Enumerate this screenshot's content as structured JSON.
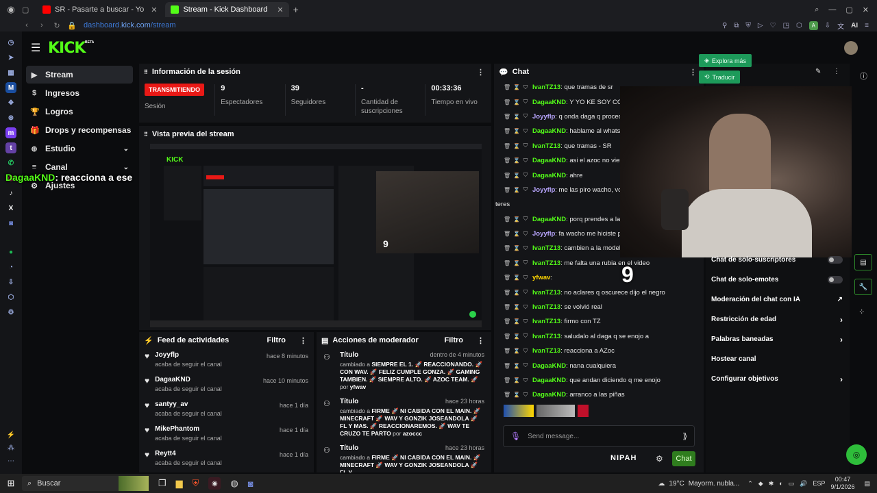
{
  "browser": {
    "tabs": [
      {
        "label": "SR - Pasarte a buscar - Yo",
        "color": "#ff0000",
        "active": false
      },
      {
        "label": "Stream - Kick Dashboard",
        "color": "#53fc18",
        "active": true
      }
    ],
    "url_domain": "dashboard.",
    "url_host": "kick.com",
    "url_path": "/stream"
  },
  "header": {
    "logo": "KICK",
    "beta": "BETA"
  },
  "nav": {
    "items": [
      {
        "label": "Stream",
        "icon": "▶"
      },
      {
        "label": "Ingresos",
        "icon": "$"
      },
      {
        "label": "Logros",
        "icon": "🏆"
      },
      {
        "label": "Drops y recompensas",
        "icon": "🎁"
      },
      {
        "label": "Estudio",
        "icon": "⊕"
      },
      {
        "label": "Canal",
        "icon": "≡"
      },
      {
        "label": "Ajustes",
        "icon": "⚙"
      }
    ],
    "overlay_user": "DagaaKND",
    "overlay_msg": ": reacciona a ese"
  },
  "session": {
    "title": "Información de la sesión",
    "status_badge": "TRANSMITIENDO",
    "status_label": "Sesión",
    "stats": [
      {
        "value": "9",
        "label": "Espectadores"
      },
      {
        "value": "39",
        "label": "Seguidores"
      },
      {
        "value": "-",
        "label": "Cantidad de suscripciones"
      },
      {
        "value": "00:33:36",
        "label": "Tiempo en vivo"
      }
    ]
  },
  "preview": {
    "title": "Vista previa del stream",
    "inner_logo": "KICK",
    "inner_number": "9"
  },
  "feed": {
    "title": "Feed de actividades",
    "filter": "Filtro",
    "items": [
      {
        "name": "Joyyflp",
        "sub": "acaba de seguir el canal",
        "time": "hace 8 minutos"
      },
      {
        "name": "DagaaKND",
        "sub": "acaba de seguir el canal",
        "time": "hace 10 minutos"
      },
      {
        "name": "santyy_av",
        "sub": "acaba de seguir el canal",
        "time": "hace 1 día"
      },
      {
        "name": "MikePhantom",
        "sub": "acaba de seguir el canal",
        "time": "hace 1 día"
      },
      {
        "name": "Reytt4",
        "sub": "acaba de seguir el canal",
        "time": "hace 1 día"
      }
    ]
  },
  "modactions": {
    "title": "Acciones de moderador",
    "filter": "Filtro",
    "items": [
      {
        "title": "Título",
        "time": "dentro de 4 minutos",
        "prefix": "cambiado a ",
        "body": "SIEMPRE EL 1. 🚀 REACCIONANDO. 🚀 CON WAV. 🚀 FELIZ CUMPLE GONZA. 🚀 GAMING TAMBIEN. 🚀 SIEMPRE ALTO. 🚀 AZOC TEAM. 🚀",
        "by": " por ",
        "user": "yfwav"
      },
      {
        "title": "Título",
        "time": "hace 23 horas",
        "prefix": "cambiado a ",
        "body": "FIRME 🚀 NI CABIDA CON EL MAIN. 🚀 MINECRAFT 🚀 WAV Y GONZIK JOSEANDOLA 🚀 FL Y MAS. 🚀 REACCIONAREMOS. 🚀 WAV TE CRUZO TE PARTO",
        "by": " por ",
        "user": "azoccc"
      },
      {
        "title": "Título",
        "time": "hace 23 horas",
        "prefix": "cambiado a ",
        "body": "FIRME 🚀 NI CABIDA CON EL MAIN. 🚀 MINECRAFT 🚀 WAV Y GONZIK JOSEANDOLA 🚀 FL Y",
        "by": "",
        "user": ""
      }
    ]
  },
  "chat": {
    "title": "Chat",
    "messages": [
      {
        "user": "IvanTZ13",
        "color": "#53fc18",
        "msg": ": que tramas de sr"
      },
      {
        "user": "DagaaKND",
        "color": "#53fc18",
        "msg": ": Y YO KE SOY COM"
      },
      {
        "user": "Joyyflp",
        "color": "#b9a6ff",
        "msg": ": q onda daga q proced"
      },
      {
        "user": "DagaaKND",
        "color": "#53fc18",
        "msg": ": hablame al whats"
      },
      {
        "user": "IvanTZ13",
        "color": "#53fc18",
        "msg": ": que tramas - SR"
      },
      {
        "user": "DagaaKND",
        "color": "#53fc18",
        "msg": ": asi el azoc no vien"
      },
      {
        "user": "DagaaKND",
        "color": "#53fc18",
        "msg": ": ahre"
      },
      {
        "user": "Joyyflp",
        "color": "#b9a6ff",
        "msg": ": me las piro wacho, vo"
      },
      {
        "user": "",
        "color": "#ffffff",
        "msg": "teres"
      },
      {
        "user": "DagaaKND",
        "color": "#53fc18",
        "msg": ": porq prendes a las"
      },
      {
        "user": "Joyyflp",
        "color": "#b9a6ff",
        "msg": ": fa wacho me hiciste p"
      },
      {
        "user": "IvanTZ13",
        "color": "#53fc18",
        "msg": ": cambien a la modelo"
      },
      {
        "user": "IvanTZ13",
        "color": "#53fc18",
        "msg": ": me falta una rubia en el video"
      },
      {
        "user": "yfwav",
        "color": "#ffd600",
        "msg": ":"
      },
      {
        "user": "IvanTZ13",
        "color": "#53fc18",
        "msg": ": no aclares q oscurece dijo el negro"
      },
      {
        "user": "IvanTZ13",
        "color": "#53fc18",
        "msg": ": se volvió real"
      },
      {
        "user": "IvanTZ13",
        "color": "#53fc18",
        "msg": ": firmo con TZ"
      },
      {
        "user": "IvanTZ13",
        "color": "#53fc18",
        "msg": ": saludalo al daga q se enojo a"
      },
      {
        "user": "IvanTZ13",
        "color": "#53fc18",
        "msg": ": reacciona a AZoc"
      },
      {
        "user": "DagaaKND",
        "color": "#53fc18",
        "msg": ": nana cualquiera"
      },
      {
        "user": "DagaaKND",
        "color": "#53fc18",
        "msg": ": que andan diciendo q me enojo"
      },
      {
        "user": "DagaaKND",
        "color": "#53fc18",
        "msg": ": arranco a las piñas"
      }
    ],
    "input_placeholder": "Send message...",
    "send_label": "Chat",
    "emote_brand": "NIPAH",
    "viewer_overlay": "9"
  },
  "stream_info": {
    "explore": "Explora más",
    "translate": "Traducir",
    "settings": [
      {
        "label": "Chat de solo-suscriptores",
        "kind": "toggle"
      },
      {
        "label": "Chat de solo-emotes",
        "kind": "toggle"
      },
      {
        "label": "Moderación del chat con IA",
        "kind": "link"
      },
      {
        "label": "Restricción de edad",
        "kind": "arrow"
      },
      {
        "label": "Palabras baneadas",
        "kind": "arrow"
      },
      {
        "label": "Hostear canal",
        "kind": "none"
      },
      {
        "label": "Configurar objetivos",
        "kind": "arrow"
      }
    ]
  },
  "taskbar": {
    "search": "Buscar",
    "weather": "19°C",
    "weather_desc": "Mayorm. nubla...",
    "lang": "ESP",
    "time": "00:47",
    "date": "9/1/2026"
  },
  "colors": {
    "accent": "#53fc18",
    "live": "#e91916",
    "panel": "#141518",
    "bg": "#0b0c0e"
  }
}
